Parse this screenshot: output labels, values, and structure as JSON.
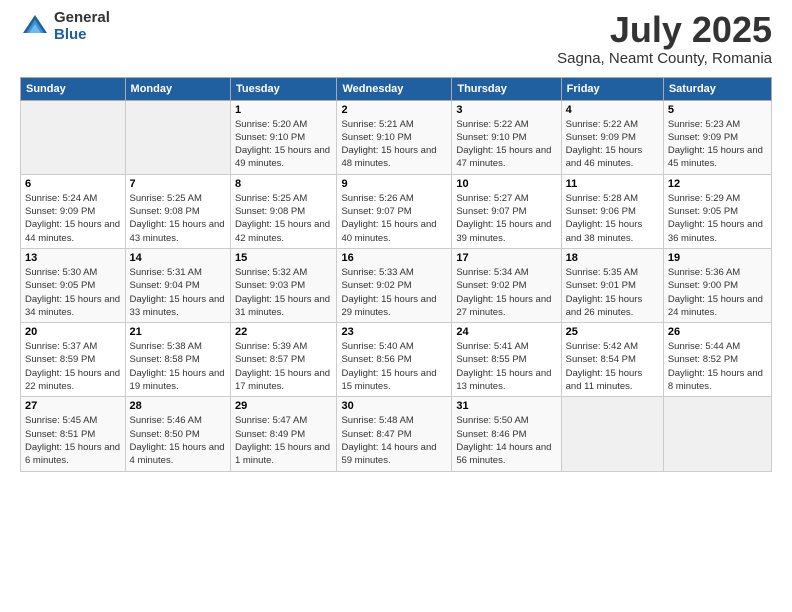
{
  "logo": {
    "general": "General",
    "blue": "Blue"
  },
  "header": {
    "title": "July 2025",
    "subtitle": "Sagna, Neamt County, Romania"
  },
  "days_of_week": [
    "Sunday",
    "Monday",
    "Tuesday",
    "Wednesday",
    "Thursday",
    "Friday",
    "Saturday"
  ],
  "weeks": [
    [
      {
        "day": "",
        "sunrise": "",
        "sunset": "",
        "daylight": "",
        "empty": true
      },
      {
        "day": "",
        "sunrise": "",
        "sunset": "",
        "daylight": "",
        "empty": true
      },
      {
        "day": "1",
        "sunrise": "Sunrise: 5:20 AM",
        "sunset": "Sunset: 9:10 PM",
        "daylight": "Daylight: 15 hours and 49 minutes.",
        "empty": false
      },
      {
        "day": "2",
        "sunrise": "Sunrise: 5:21 AM",
        "sunset": "Sunset: 9:10 PM",
        "daylight": "Daylight: 15 hours and 48 minutes.",
        "empty": false
      },
      {
        "day": "3",
        "sunrise": "Sunrise: 5:22 AM",
        "sunset": "Sunset: 9:10 PM",
        "daylight": "Daylight: 15 hours and 47 minutes.",
        "empty": false
      },
      {
        "day": "4",
        "sunrise": "Sunrise: 5:22 AM",
        "sunset": "Sunset: 9:09 PM",
        "daylight": "Daylight: 15 hours and 46 minutes.",
        "empty": false
      },
      {
        "day": "5",
        "sunrise": "Sunrise: 5:23 AM",
        "sunset": "Sunset: 9:09 PM",
        "daylight": "Daylight: 15 hours and 45 minutes.",
        "empty": false
      }
    ],
    [
      {
        "day": "6",
        "sunrise": "Sunrise: 5:24 AM",
        "sunset": "Sunset: 9:09 PM",
        "daylight": "Daylight: 15 hours and 44 minutes.",
        "empty": false
      },
      {
        "day": "7",
        "sunrise": "Sunrise: 5:25 AM",
        "sunset": "Sunset: 9:08 PM",
        "daylight": "Daylight: 15 hours and 43 minutes.",
        "empty": false
      },
      {
        "day": "8",
        "sunrise": "Sunrise: 5:25 AM",
        "sunset": "Sunset: 9:08 PM",
        "daylight": "Daylight: 15 hours and 42 minutes.",
        "empty": false
      },
      {
        "day": "9",
        "sunrise": "Sunrise: 5:26 AM",
        "sunset": "Sunset: 9:07 PM",
        "daylight": "Daylight: 15 hours and 40 minutes.",
        "empty": false
      },
      {
        "day": "10",
        "sunrise": "Sunrise: 5:27 AM",
        "sunset": "Sunset: 9:07 PM",
        "daylight": "Daylight: 15 hours and 39 minutes.",
        "empty": false
      },
      {
        "day": "11",
        "sunrise": "Sunrise: 5:28 AM",
        "sunset": "Sunset: 9:06 PM",
        "daylight": "Daylight: 15 hours and 38 minutes.",
        "empty": false
      },
      {
        "day": "12",
        "sunrise": "Sunrise: 5:29 AM",
        "sunset": "Sunset: 9:05 PM",
        "daylight": "Daylight: 15 hours and 36 minutes.",
        "empty": false
      }
    ],
    [
      {
        "day": "13",
        "sunrise": "Sunrise: 5:30 AM",
        "sunset": "Sunset: 9:05 PM",
        "daylight": "Daylight: 15 hours and 34 minutes.",
        "empty": false
      },
      {
        "day": "14",
        "sunrise": "Sunrise: 5:31 AM",
        "sunset": "Sunset: 9:04 PM",
        "daylight": "Daylight: 15 hours and 33 minutes.",
        "empty": false
      },
      {
        "day": "15",
        "sunrise": "Sunrise: 5:32 AM",
        "sunset": "Sunset: 9:03 PM",
        "daylight": "Daylight: 15 hours and 31 minutes.",
        "empty": false
      },
      {
        "day": "16",
        "sunrise": "Sunrise: 5:33 AM",
        "sunset": "Sunset: 9:02 PM",
        "daylight": "Daylight: 15 hours and 29 minutes.",
        "empty": false
      },
      {
        "day": "17",
        "sunrise": "Sunrise: 5:34 AM",
        "sunset": "Sunset: 9:02 PM",
        "daylight": "Daylight: 15 hours and 27 minutes.",
        "empty": false
      },
      {
        "day": "18",
        "sunrise": "Sunrise: 5:35 AM",
        "sunset": "Sunset: 9:01 PM",
        "daylight": "Daylight: 15 hours and 26 minutes.",
        "empty": false
      },
      {
        "day": "19",
        "sunrise": "Sunrise: 5:36 AM",
        "sunset": "Sunset: 9:00 PM",
        "daylight": "Daylight: 15 hours and 24 minutes.",
        "empty": false
      }
    ],
    [
      {
        "day": "20",
        "sunrise": "Sunrise: 5:37 AM",
        "sunset": "Sunset: 8:59 PM",
        "daylight": "Daylight: 15 hours and 22 minutes.",
        "empty": false
      },
      {
        "day": "21",
        "sunrise": "Sunrise: 5:38 AM",
        "sunset": "Sunset: 8:58 PM",
        "daylight": "Daylight: 15 hours and 19 minutes.",
        "empty": false
      },
      {
        "day": "22",
        "sunrise": "Sunrise: 5:39 AM",
        "sunset": "Sunset: 8:57 PM",
        "daylight": "Daylight: 15 hours and 17 minutes.",
        "empty": false
      },
      {
        "day": "23",
        "sunrise": "Sunrise: 5:40 AM",
        "sunset": "Sunset: 8:56 PM",
        "daylight": "Daylight: 15 hours and 15 minutes.",
        "empty": false
      },
      {
        "day": "24",
        "sunrise": "Sunrise: 5:41 AM",
        "sunset": "Sunset: 8:55 PM",
        "daylight": "Daylight: 15 hours and 13 minutes.",
        "empty": false
      },
      {
        "day": "25",
        "sunrise": "Sunrise: 5:42 AM",
        "sunset": "Sunset: 8:54 PM",
        "daylight": "Daylight: 15 hours and 11 minutes.",
        "empty": false
      },
      {
        "day": "26",
        "sunrise": "Sunrise: 5:44 AM",
        "sunset": "Sunset: 8:52 PM",
        "daylight": "Daylight: 15 hours and 8 minutes.",
        "empty": false
      }
    ],
    [
      {
        "day": "27",
        "sunrise": "Sunrise: 5:45 AM",
        "sunset": "Sunset: 8:51 PM",
        "daylight": "Daylight: 15 hours and 6 minutes.",
        "empty": false
      },
      {
        "day": "28",
        "sunrise": "Sunrise: 5:46 AM",
        "sunset": "Sunset: 8:50 PM",
        "daylight": "Daylight: 15 hours and 4 minutes.",
        "empty": false
      },
      {
        "day": "29",
        "sunrise": "Sunrise: 5:47 AM",
        "sunset": "Sunset: 8:49 PM",
        "daylight": "Daylight: 15 hours and 1 minute.",
        "empty": false
      },
      {
        "day": "30",
        "sunrise": "Sunrise: 5:48 AM",
        "sunset": "Sunset: 8:47 PM",
        "daylight": "Daylight: 14 hours and 59 minutes.",
        "empty": false
      },
      {
        "day": "31",
        "sunrise": "Sunrise: 5:50 AM",
        "sunset": "Sunset: 8:46 PM",
        "daylight": "Daylight: 14 hours and 56 minutes.",
        "empty": false
      },
      {
        "day": "",
        "sunrise": "",
        "sunset": "",
        "daylight": "",
        "empty": true
      },
      {
        "day": "",
        "sunrise": "",
        "sunset": "",
        "daylight": "",
        "empty": true
      }
    ]
  ]
}
